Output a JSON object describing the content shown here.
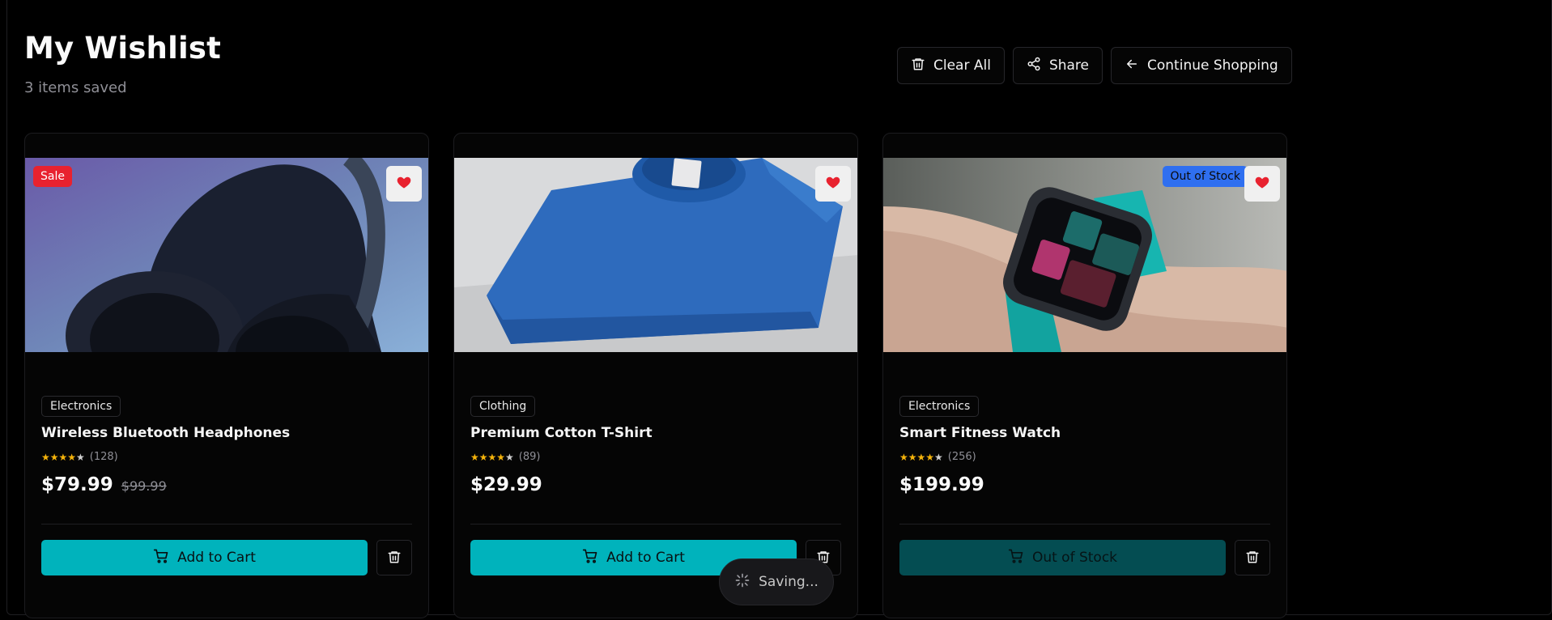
{
  "header": {
    "title": "My Wishlist",
    "subtitle": "3 items saved",
    "actions": {
      "clear_all": "Clear All",
      "share": "Share",
      "continue_shopping": "Continue Shopping"
    }
  },
  "colors": {
    "accent": "#00b3bc",
    "accent_disabled": "#044d52",
    "sale_badge": "#e8222f",
    "stock_badge": "#2f6ff0",
    "star": "#f5b40b",
    "heart": "#e8222f"
  },
  "products": [
    {
      "badge": "Sale",
      "category": "Electronics",
      "name": "Wireless Bluetooth Headphones",
      "rating": 4,
      "reviews": "(128)",
      "price": "$79.99",
      "old_price": "$99.99",
      "action": "Add to Cart",
      "image_icon": "headphones-photo"
    },
    {
      "badge": "",
      "category": "Clothing",
      "name": "Premium Cotton T-Shirt",
      "rating": 4,
      "reviews": "(89)",
      "price": "$29.99",
      "old_price": "",
      "action": "Add to Cart",
      "image_icon": "tshirt-photo"
    },
    {
      "badge": "Out of Stock",
      "category": "Electronics",
      "name": "Smart Fitness Watch",
      "rating": 4,
      "reviews": "(256)",
      "price": "$199.99",
      "old_price": "",
      "action": "Out of Stock",
      "image_icon": "smartwatch-photo"
    }
  ],
  "toast": {
    "label": "Saving..."
  }
}
